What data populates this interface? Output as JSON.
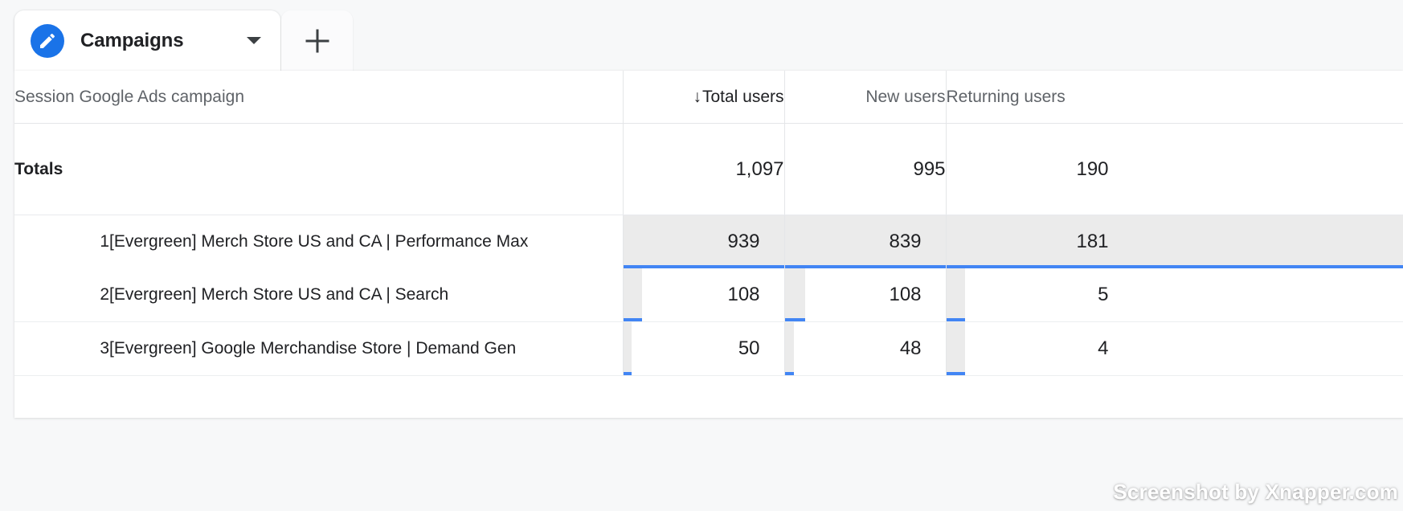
{
  "tabs": {
    "active": {
      "label": "Campaigns",
      "icon": "pencil-icon",
      "caret_icon": "chevron-down-icon",
      "accent_color": "#1a73e8"
    },
    "add": {
      "label": "+",
      "icon": "plus-icon"
    }
  },
  "table": {
    "columns": [
      {
        "key": "dimension",
        "label": "Session Google Ads campaign",
        "align": "left",
        "sorted": false
      },
      {
        "key": "total_users",
        "label": "Total users",
        "align": "right",
        "sorted": true,
        "sort_arrow": "↓",
        "sort_direction": "descending"
      },
      {
        "key": "new_users",
        "label": "New users",
        "align": "right",
        "sorted": false
      },
      {
        "key": "returning_users",
        "label": "Returning users",
        "align": "right",
        "sorted": false
      }
    ],
    "totals": {
      "label": "Totals",
      "total_users": "1,097",
      "new_users": "995",
      "returning_users": "190"
    },
    "rows": [
      {
        "index": "1",
        "dimension": "[Evergreen] Merch Store US and CA | Performance Max",
        "total_users": "939",
        "new_users": "839",
        "returning_users": "181",
        "highlighted": true
      },
      {
        "index": "2",
        "dimension": "[Evergreen] Merch Store US and CA | Search",
        "total_users": "108",
        "new_users": "108",
        "returning_users": "5",
        "highlighted": false
      },
      {
        "index": "3",
        "dimension": "[Evergreen] Google Merchandise Store | Demand Gen",
        "total_users": "50",
        "new_users": "48",
        "returning_users": "4",
        "highlighted": false
      }
    ]
  },
  "chart_data": {
    "type": "table",
    "title": "Session Google Ads campaign by users",
    "categories": [
      "[Evergreen] Merch Store US and CA | Performance Max",
      "[Evergreen] Merch Store US and CA | Search",
      "[Evergreen] Google Merchandise Store | Demand Gen"
    ],
    "series": [
      {
        "name": "Total users",
        "values": [
          939,
          108,
          50
        ],
        "total": 1097
      },
      {
        "name": "New users",
        "values": [
          839,
          108,
          48
        ],
        "total": 995
      },
      {
        "name": "Returning users",
        "values": [
          181,
          5,
          4
        ],
        "total": 190
      }
    ],
    "bar_color": "#4285f4",
    "bar_track_color": "#ebebeb",
    "sorted_by": "Total users",
    "sort_direction": "descending"
  },
  "watermark": {
    "text": "Screenshot by Xnapper.com"
  }
}
